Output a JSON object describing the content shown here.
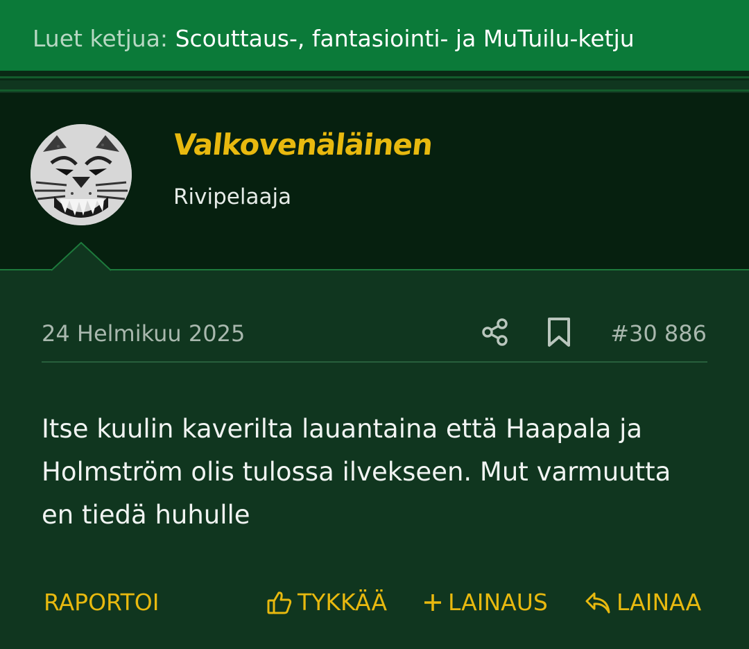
{
  "thread_bar": {
    "prefix": "Luet ketjua:",
    "title": "Scouttaus-, fantasiointi- ja MuTuilu-ketju"
  },
  "user": {
    "name": "Valkovenäläinen",
    "title": "Rivipelaaja",
    "avatar_icon": "lynx-avatar-icon"
  },
  "post": {
    "date": "24 Helmikuu 2025",
    "number": "#30 886",
    "body": "Itse kuulin kaverilta lauantaina että Haapala ja Holmström olis tulossa ilvekseen. Mut varmuutta en tiedä huhulle"
  },
  "actions": {
    "report": "RAPORTOI",
    "like": "TYKKÄÄ",
    "multiquote": "LAINAUS",
    "reply": "LAINAA"
  },
  "icons": {
    "share": "share-icon",
    "bookmark": "bookmark-icon",
    "like": "thumbs-up-icon",
    "multiquote": "plus-icon",
    "reply": "reply-icon"
  },
  "colors": {
    "thread_bar": "#0b7a39",
    "user_panel": "#06200f",
    "page_background": "#10361f",
    "accent_yellow": "#e8b90f"
  }
}
